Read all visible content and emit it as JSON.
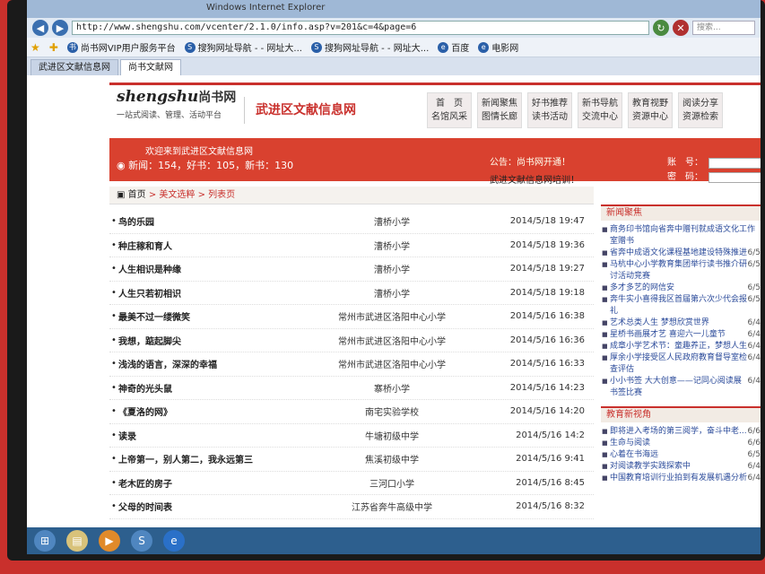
{
  "browser": {
    "window_title": "Windows Internet Explorer",
    "url": "http://www.shengshu.com/vcenter/2.1.0/info.asp?v=201&c=4&page=6",
    "search_placeholder": "搜索...",
    "favorites": [
      {
        "label": "尚书网VIP用户服务平台",
        "icon": "shangshu-icon"
      },
      {
        "label": "搜狗网址导航 - - 网址大...",
        "icon": "sogou-icon"
      },
      {
        "label": "搜狗网址导航 - - 网址大...",
        "icon": "sogou-icon"
      },
      {
        "label": "百度",
        "icon": "ie-icon"
      },
      {
        "label": "电影网",
        "icon": "ie-icon"
      }
    ],
    "tabs": [
      {
        "label": "武进区文献信息网"
      },
      {
        "label": "尚书文献网"
      }
    ]
  },
  "site": {
    "logo_text": "shengshu",
    "logo_cn": "尚书网",
    "logo_sub": "一站式阅读、管理、活动平台",
    "title": "武进区文献信息网",
    "nav": [
      {
        "line1": "首　页",
        "line2": "名馆风采"
      },
      {
        "line1": "新闻聚焦",
        "line2": "图情长廊"
      },
      {
        "line1": "好书推荐",
        "line2": "读书活动"
      },
      {
        "line1": "新书导航",
        "line2": "交流中心"
      },
      {
        "line1": "教育视野",
        "line2": "资源中心"
      },
      {
        "line1": "阅读分享",
        "line2": "资源检索"
      }
    ],
    "welcome": "欢迎来到武进区文献信息网",
    "stats": "新闻：154，好书：105，新书：130",
    "notice": "公告：尚书网开通！",
    "notice2": "武进文献信息网培训！",
    "login_user": "账　号：",
    "login_pass": "密　码："
  },
  "breadcrumb": {
    "home": "首页",
    "sep": ">",
    "section": "美文选粹",
    "page": "列表页"
  },
  "articles": [
    {
      "title": "鸟的乐园",
      "school": "漕桥小学",
      "date": "2014/5/18 19:47"
    },
    {
      "title": "种庄稼和育人",
      "school": "漕桥小学",
      "date": "2014/5/18 19:36"
    },
    {
      "title": "人生相识是种缘",
      "school": "漕桥小学",
      "date": "2014/5/18 19:27"
    },
    {
      "title": "人生只若初相识",
      "school": "漕桥小学",
      "date": "2014/5/18 19:18"
    },
    {
      "title": "最美不过一缕微笑",
      "school": "常州市武进区洛阳中心小学",
      "date": "2014/5/16 16:38"
    },
    {
      "title": "我想，踮起脚尖",
      "school": "常州市武进区洛阳中心小学",
      "date": "2014/5/16 16:36"
    },
    {
      "title": "浅浅的语言，深深的幸福",
      "school": "常州市武进区洛阳中心小学",
      "date": "2014/5/16 16:33"
    },
    {
      "title": "神奇的光头鼠",
      "school": "寨桥小学",
      "date": "2014/5/16 14:23"
    },
    {
      "title": "《夏洛的网》",
      "school": "南宅实验学校",
      "date": "2014/5/16 14:20"
    },
    {
      "title": "读录",
      "school": "牛塘初级中学",
      "date": "2014/5/16 14:2"
    },
    {
      "title": "上帝第一，别人第二，我永远第三",
      "school": "焦溪初级中学",
      "date": "2014/5/16 9:41"
    },
    {
      "title": "老木匠的房子",
      "school": "三河口小学",
      "date": "2014/5/16 8:45"
    },
    {
      "title": "父母的时间表",
      "school": "江苏省奔牛高级中学",
      "date": "2014/5/16 8:32"
    }
  ],
  "news_panel": {
    "head": "新闻聚焦",
    "items": [
      {
        "text": "商务印书馆向省奔中赠刊就成语文化工作室赠书",
        "date": ""
      },
      {
        "text": "省奔中成语文化课程基地建设特殊推进",
        "date": "6/5"
      },
      {
        "text": "马杭中心小学教育集团举行读书推介研讨活动竞赛",
        "date": "6/5"
      },
      {
        "text": "多才多艺的网信安",
        "date": "6/5"
      },
      {
        "text": "奔牛实小喜得我区首届第六次少代会报礼",
        "date": "6/5"
      },
      {
        "text": "艺术总类人生 梦想欣赏世界",
        "date": "6/4"
      },
      {
        "text": "星桥书画展才艺 喜迎六一儿童节",
        "date": "6/4"
      },
      {
        "text": "成章小学艺术节：童趣养正，梦想人生",
        "date": "6/4"
      },
      {
        "text": "厚余小学接受区人民政府教育督导室检查评估",
        "date": "6/4"
      },
      {
        "text": "小小书签 大大创意——记同心阅读展书签比赛",
        "date": "6/4"
      }
    ],
    "head2": "教育新视角",
    "items2": [
      {
        "text": "即将进入考场的第三阅学，奋斗中老...",
        "date": "6/6"
      },
      {
        "text": "生命与阅读",
        "date": "6/6"
      },
      {
        "text": "心着在书海远",
        "date": "6/5"
      },
      {
        "text": "对阅读教学实践探索中",
        "date": "6/4"
      },
      {
        "text": "中国教育培训行业拍到有发展机遇分析",
        "date": "6/4"
      }
    ]
  }
}
